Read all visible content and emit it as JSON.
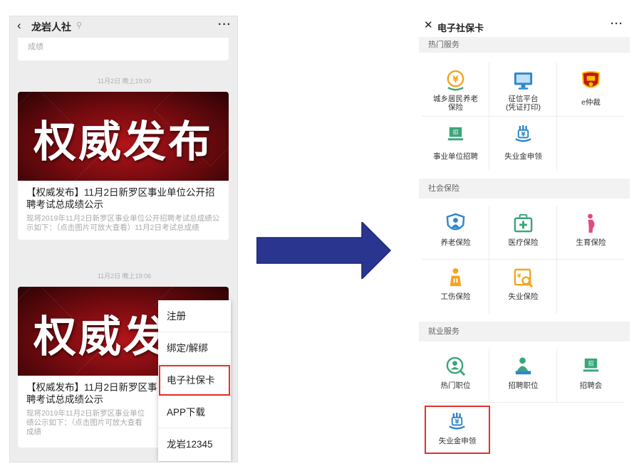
{
  "left_phone": {
    "back_glyph": "‹",
    "title": "龙岩人社",
    "location_glyph": "⚲",
    "more_glyph": "···",
    "prev_card_tail": "成绩",
    "articles": [
      {
        "timestamp": "11月2日 晚上19:00",
        "image_text": "权威发布",
        "title": "【权威发布】11月2日新罗区事业单位公开招聘考试总成绩公示",
        "desc": "现将2019年11月2日新罗区事业单位公开招聘考试总成绩公示如下：（点击图片可放大查看）11月2日考试总成绩"
      },
      {
        "timestamp": "11月2日 晚上19:06",
        "image_text": "权威发",
        "title": "【权威发布】11月2日新罗区事",
        "title_line2": "聘考试总成绩公示",
        "desc": "现将2019年11月2日新罗区事业单位",
        "desc_line2": "绩公示如下：（点击图片可放大查看",
        "desc_line3": "成绩"
      }
    ],
    "menu": [
      "注册",
      "绑定/解绑",
      "电子社保卡",
      "APP下载",
      "龙岩12345"
    ],
    "menu_highlight_index": 2
  },
  "right_phone": {
    "close_glyph": "✕",
    "title": "电子社保卡",
    "more_glyph": "···",
    "sections": [
      {
        "header": "热门服务",
        "items": [
          {
            "label": "城乡居民养老\n保险",
            "icon": "yuan-coin-icon"
          },
          {
            "label": "征信平台\n(凭证打印)",
            "icon": "monitor-icon"
          },
          {
            "label": "e仲裁",
            "icon": "emblem-icon"
          },
          {
            "label": "事业单位招聘",
            "icon": "recruit-flag-icon"
          },
          {
            "label": "失业金申领",
            "icon": "benefit-hand-icon"
          }
        ]
      },
      {
        "header": "社会保险",
        "items": [
          {
            "label": "养老保险",
            "icon": "elderly-shield-icon"
          },
          {
            "label": "医疗保险",
            "icon": "medical-kit-icon"
          },
          {
            "label": "生育保险",
            "icon": "pregnant-woman-icon"
          },
          {
            "label": "工伤保险",
            "icon": "injured-person-icon"
          },
          {
            "label": "失业保险",
            "icon": "unemployment-search-icon"
          }
        ]
      },
      {
        "header": "就业服务",
        "items": [
          {
            "label": "热门职位",
            "icon": "job-search-icon"
          },
          {
            "label": "招聘职位",
            "icon": "recruiter-icon"
          },
          {
            "label": "招聘会",
            "icon": "job-fair-flag-icon"
          },
          {
            "label": "失业金申领",
            "icon": "benefit-hand-icon"
          }
        ]
      }
    ],
    "highlighted_item": "失业金申领"
  },
  "colors": {
    "highlight_red": "#e0322e",
    "arrow_blue": "#2a3590",
    "icon_green": "#3aa57a",
    "icon_blue": "#2f86c9",
    "icon_orange": "#f2a51f",
    "icon_pink": "#e04a86"
  }
}
